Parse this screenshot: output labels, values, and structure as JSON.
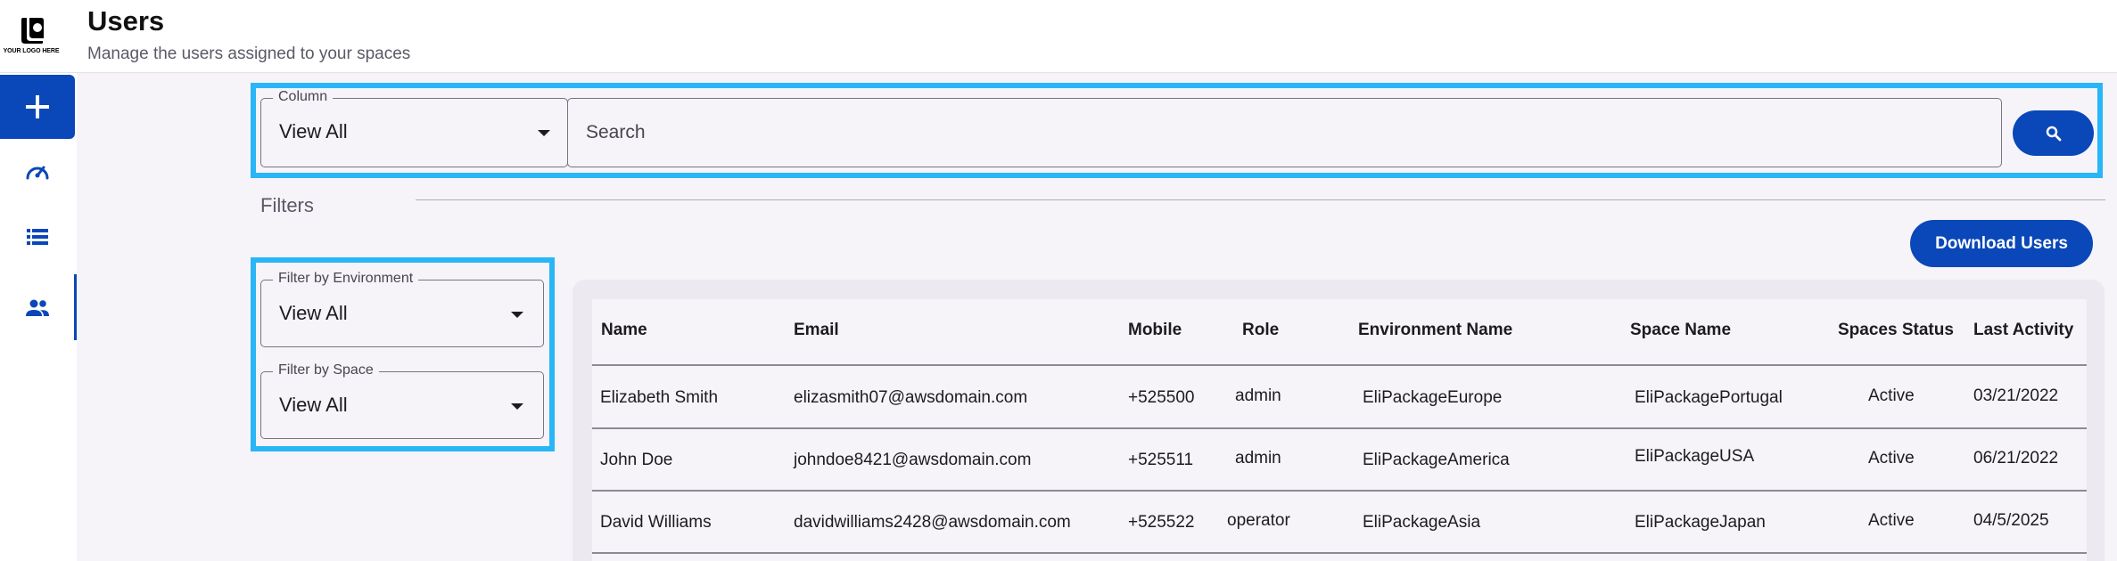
{
  "brand": {
    "logo_text": "YOUR LOGO HERE"
  },
  "header": {
    "title": "Users",
    "subtitle": "Manage the users assigned to your spaces"
  },
  "rail": {
    "items": [
      {
        "icon": "plus-icon",
        "active": false
      },
      {
        "icon": "speedometer-icon",
        "active": false
      },
      {
        "icon": "list-icon",
        "active": false
      },
      {
        "icon": "people-icon",
        "active": true
      }
    ]
  },
  "search": {
    "column_label": "Column",
    "column_value": "View All",
    "placeholder": "Search",
    "value": ""
  },
  "filters": {
    "label": "Filters",
    "environment": {
      "label": "Filter by Environment",
      "value": "View All"
    },
    "space": {
      "label": "Filter by Space",
      "value": "View All"
    }
  },
  "actions": {
    "download_label": "Download Users"
  },
  "table": {
    "columns": [
      "Name",
      "Email",
      "Mobile",
      "Role",
      "Environment Name",
      "Space Name",
      "Spaces Status",
      "Last Activity"
    ],
    "rows": [
      [
        "Elizabeth Smith",
        "elizasmith07@awsdomain.com",
        "+525500",
        "admin",
        "EliPackageEurope",
        "EliPackagePortugal",
        "Active",
        "03/21/2022"
      ],
      [
        "John Doe",
        "johndoe8421@awsdomain.com",
        "+525511",
        "admin",
        "EliPackageAmerica",
        "EliPackageUSA",
        "Active",
        "06/21/2022"
      ],
      [
        "David Williams",
        "davidwilliams2428@awsdomain.com",
        "+525522",
        "operator",
        "EliPackageAsia",
        "EliPackageJapan",
        "Active",
        "04/5/2025"
      ]
    ]
  },
  "colors": {
    "primary": "#0a47b8",
    "highlight": "#29b6f6",
    "background": "#f6f3f9"
  }
}
